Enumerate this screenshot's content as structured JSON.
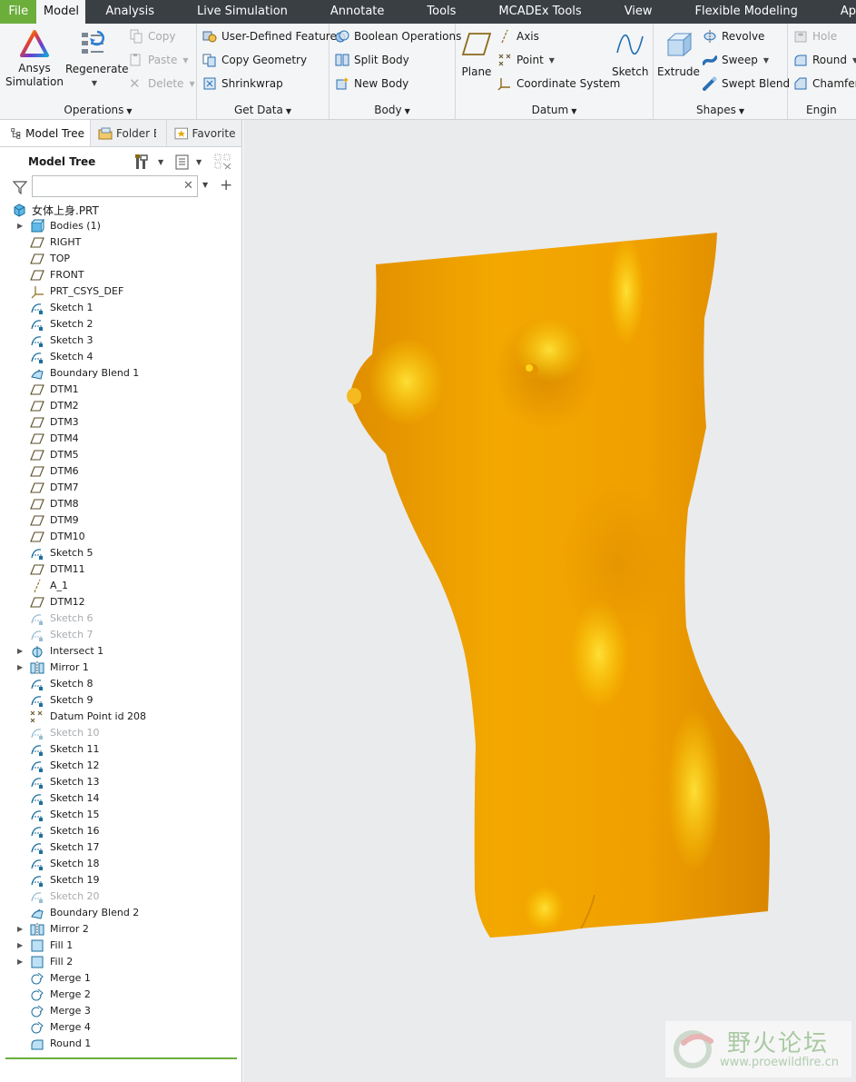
{
  "menu": {
    "tabs": [
      {
        "label": "File"
      },
      {
        "label": "Model"
      },
      {
        "label": "Analysis"
      },
      {
        "label": "Live Simulation"
      },
      {
        "label": "Annotate"
      },
      {
        "label": "Tools"
      },
      {
        "label": "MCADEx Tools"
      },
      {
        "label": "View"
      },
      {
        "label": "Flexible Modeling"
      },
      {
        "label": "Ap"
      }
    ]
  },
  "ribbon": {
    "operations": {
      "label": "Operations",
      "ansys": "Ansys\nSimulation",
      "regenerate": "Regenerate",
      "copy": "Copy",
      "paste": "Paste",
      "delete": "Delete"
    },
    "get_data": {
      "label": "Get Data",
      "udf": "User-Defined Feature",
      "copy_geometry": "Copy Geometry",
      "shrinkwrap": "Shrinkwrap"
    },
    "body": {
      "label": "Body",
      "boolean": "Boolean Operations",
      "split": "Split Body",
      "new": "New Body"
    },
    "datum": {
      "label": "Datum",
      "plane": "Plane",
      "axis": "Axis",
      "point": "Point",
      "csys": "Coordinate System",
      "sketch": "Sketch"
    },
    "shapes": {
      "label": "Shapes",
      "extrude": "Extrude",
      "revolve": "Revolve",
      "sweep": "Sweep",
      "swept_blend": "Swept Blend"
    },
    "engineering": {
      "label": "Engin",
      "hole": "Hole",
      "round": "Round",
      "chamfer": "Chamfer"
    }
  },
  "panel": {
    "tabs": [
      {
        "label": "Model Tree"
      },
      {
        "label": "Folder B"
      },
      {
        "label": "Favorite"
      }
    ],
    "tree_title": "Model Tree",
    "filter_placeholder": ""
  },
  "tree": {
    "root": "女体上身.PRT",
    "items": [
      {
        "label": "Bodies (1)",
        "icon": "body-icon",
        "expand": true
      },
      {
        "label": "RIGHT",
        "icon": "plane-icon"
      },
      {
        "label": "TOP",
        "icon": "plane-icon"
      },
      {
        "label": "FRONT",
        "icon": "plane-icon"
      },
      {
        "label": "PRT_CSYS_DEF",
        "icon": "csys-icon"
      },
      {
        "label": "Sketch 1",
        "icon": "sketch-icon"
      },
      {
        "label": "Sketch 2",
        "icon": "sketch-icon"
      },
      {
        "label": "Sketch 3",
        "icon": "sketch-icon"
      },
      {
        "label": "Sketch 4",
        "icon": "sketch-icon"
      },
      {
        "label": "Boundary Blend 1",
        "icon": "boundary-blend-icon"
      },
      {
        "label": "DTM1",
        "icon": "plane-icon"
      },
      {
        "label": "DTM2",
        "icon": "plane-icon"
      },
      {
        "label": "DTM3",
        "icon": "plane-icon"
      },
      {
        "label": "DTM4",
        "icon": "plane-icon"
      },
      {
        "label": "DTM5",
        "icon": "plane-icon"
      },
      {
        "label": "DTM6",
        "icon": "plane-icon"
      },
      {
        "label": "DTM7",
        "icon": "plane-icon"
      },
      {
        "label": "DTM8",
        "icon": "plane-icon"
      },
      {
        "label": "DTM9",
        "icon": "plane-icon"
      },
      {
        "label": "DTM10",
        "icon": "plane-icon"
      },
      {
        "label": "Sketch 5",
        "icon": "sketch-icon"
      },
      {
        "label": "DTM11",
        "icon": "plane-icon"
      },
      {
        "label": "A_1",
        "icon": "axis-icon"
      },
      {
        "label": "DTM12",
        "icon": "plane-icon"
      },
      {
        "label": "Sketch 6",
        "icon": "sketch-icon",
        "suppressed": true
      },
      {
        "label": "Sketch 7",
        "icon": "sketch-icon",
        "suppressed": true
      },
      {
        "label": "Intersect 1",
        "icon": "intersect-icon",
        "expand": true
      },
      {
        "label": "Mirror 1",
        "icon": "mirror-icon",
        "expand": true
      },
      {
        "label": "Sketch 8",
        "icon": "sketch-icon"
      },
      {
        "label": "Sketch 9",
        "icon": "sketch-icon"
      },
      {
        "label": "Datum Point id 208",
        "icon": "datum-point-icon"
      },
      {
        "label": "Sketch 10",
        "icon": "sketch-icon",
        "suppressed": true
      },
      {
        "label": "Sketch 11",
        "icon": "sketch-icon"
      },
      {
        "label": "Sketch 12",
        "icon": "sketch-icon"
      },
      {
        "label": "Sketch 13",
        "icon": "sketch-icon"
      },
      {
        "label": "Sketch 14",
        "icon": "sketch-icon"
      },
      {
        "label": "Sketch 15",
        "icon": "sketch-icon"
      },
      {
        "label": "Sketch 16",
        "icon": "sketch-icon"
      },
      {
        "label": "Sketch 17",
        "icon": "sketch-icon"
      },
      {
        "label": "Sketch 18",
        "icon": "sketch-icon"
      },
      {
        "label": "Sketch 19",
        "icon": "sketch-icon"
      },
      {
        "label": "Sketch 20",
        "icon": "sketch-icon",
        "suppressed": true
      },
      {
        "label": "Boundary Blend 2",
        "icon": "boundary-blend-icon"
      },
      {
        "label": "Mirror 2",
        "icon": "mirror-icon",
        "expand": true
      },
      {
        "label": "Fill 1",
        "icon": "fill-icon",
        "expand": true
      },
      {
        "label": "Fill 2",
        "icon": "fill-icon",
        "expand": true
      },
      {
        "label": "Merge 1",
        "icon": "merge-icon"
      },
      {
        "label": "Merge 2",
        "icon": "merge-icon"
      },
      {
        "label": "Merge 3",
        "icon": "merge-icon"
      },
      {
        "label": "Merge 4",
        "icon": "merge-icon"
      },
      {
        "label": "Round 1",
        "icon": "round-icon"
      }
    ]
  },
  "watermark": {
    "text": "野火论坛",
    "url": "www.proewildfire.cn"
  },
  "colors": {
    "accent": "#6cae3b",
    "menubar": "#3a3f44",
    "model": "#f3a400",
    "viewport": "#eaebed"
  }
}
